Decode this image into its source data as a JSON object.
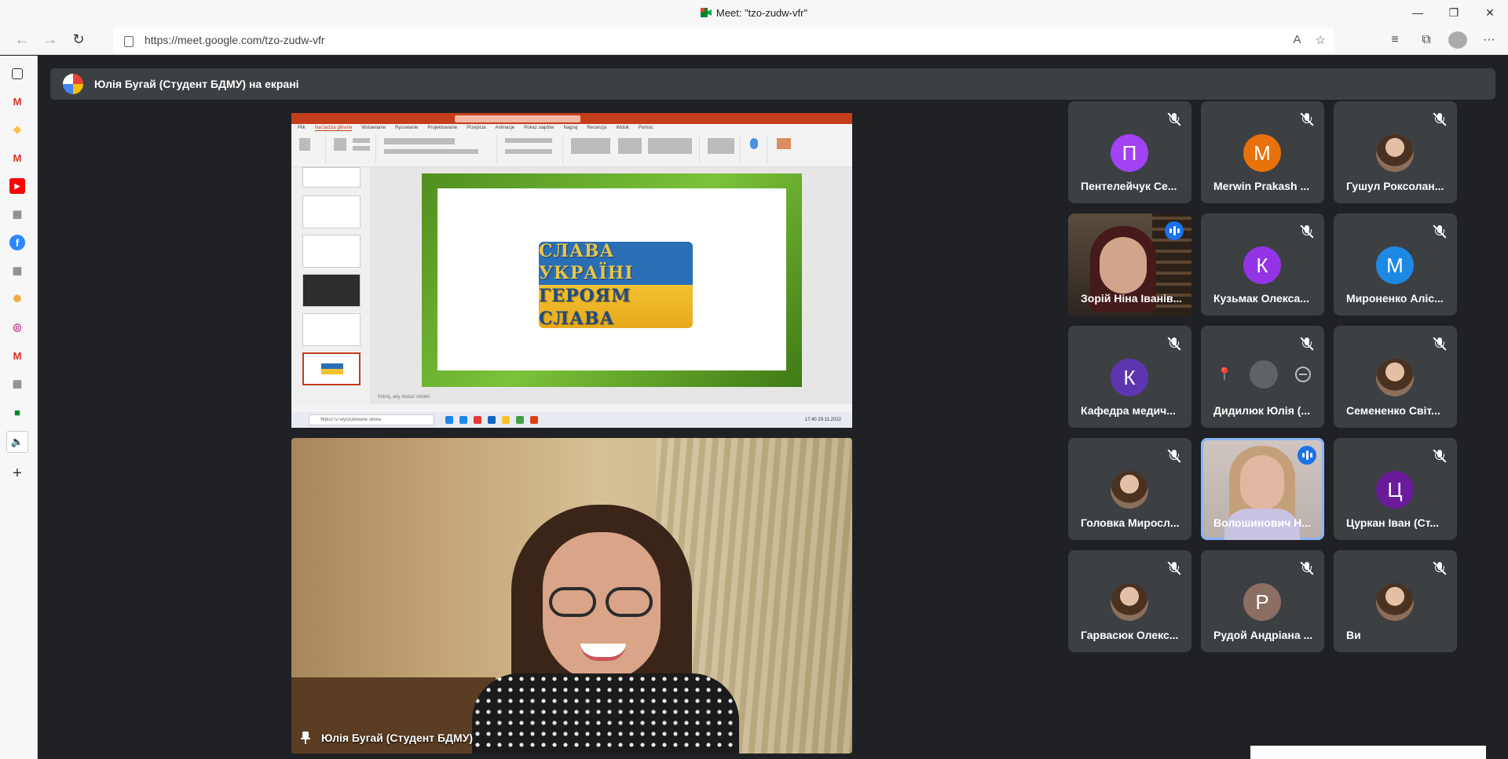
{
  "window": {
    "title": "Meet: \"tzo-zudw-vfr\"",
    "minimize": "—",
    "restore": "❐",
    "close": "✕"
  },
  "browser": {
    "url": "https://meet.google.com/tzo-zudw-vfr",
    "back_icon": "←",
    "forward_icon": "→",
    "refresh_icon": "↻",
    "read_aloud_icon": "A",
    "favorite_icon": "☆",
    "favorites_icon": "≡",
    "collections_icon": "⧉",
    "menu_icon": "···"
  },
  "sidebar_add": "+",
  "banner": {
    "text": "Юлія Бугай (Студент БДМУ) на екрані"
  },
  "shared_screen": {
    "ppt_tabs": [
      "Plik",
      "Narzędzia główne",
      "Wstawianie",
      "Rysowanie",
      "Projektowanie",
      "Przejścia",
      "Animacje",
      "Pokaz slajdów",
      "Nagraj",
      "Recenzja",
      "Widok",
      "Pomoc"
    ],
    "slide_line1": "СЛАВА УКРАЇНІ",
    "slide_line2": "ГЕРОЯМ СЛАВА",
    "notes": "Kliknij, aby dodać notatki",
    "taskbar_search": "Wpisz tu wyszukiwane słowa",
    "taskbar_time": "17:40 29.11.2022"
  },
  "presenter": {
    "name": "Юлія Бугай (Студент БДМУ)"
  },
  "participants": [
    {
      "name": "Пентелейчук Се...",
      "initial": "П",
      "color": "#a142f4",
      "type": "avatar",
      "muted": true
    },
    {
      "name": "Merwin Prakash ...",
      "initial": "M",
      "color": "#e8710a",
      "type": "avatar",
      "muted": true
    },
    {
      "name": "Гушул Роксолан...",
      "initial": "",
      "color": "#7a5a48",
      "type": "photo",
      "muted": true
    },
    {
      "name": "Зорій Ніна Івaнів...",
      "initial": "",
      "color": "",
      "type": "video",
      "muted": false
    },
    {
      "name": "Кузьмак Олекса...",
      "initial": "К",
      "color": "#9334e6",
      "type": "avatar",
      "muted": true
    },
    {
      "name": "Мироненко Аліс...",
      "initial": "М",
      "color": "#1e88e5",
      "type": "avatar",
      "muted": true
    },
    {
      "name": "Кафедра медич...",
      "initial": "К",
      "color": "#5e35b1",
      "type": "avatar",
      "muted": true
    },
    {
      "name": "Дидилюк Юлія (...",
      "initial": "",
      "color": "",
      "type": "pinned",
      "muted": true
    },
    {
      "name": "Семененко Світ...",
      "initial": "",
      "color": "#b07c55",
      "type": "photo",
      "muted": true
    },
    {
      "name": "Головка Миросл...",
      "initial": "",
      "color": "#b1435e",
      "type": "photo",
      "muted": true
    },
    {
      "name": "Волошинович Н...",
      "initial": "",
      "color": "",
      "type": "video2",
      "muted": false
    },
    {
      "name": "Цуркан Іван (Ст...",
      "initial": "Ц",
      "color": "#6a1b9a",
      "type": "avatar",
      "muted": true
    },
    {
      "name": "Гарвасюк Олекс...",
      "initial": "",
      "color": "#8fa8b8",
      "type": "photo",
      "muted": true
    },
    {
      "name": "Рудой Андріана ...",
      "initial": "Р",
      "color": "#8d6e63",
      "type": "avatar",
      "muted": true
    },
    {
      "name": "Ви",
      "initial": "",
      "color": "#6b5a5a",
      "type": "photo",
      "muted": true
    }
  ],
  "colors": {
    "meet_bg": "#202124",
    "tile_bg": "#3c4043",
    "speaking_outline": "#8ab4f8",
    "speaking_badge": "#1a73e8"
  }
}
